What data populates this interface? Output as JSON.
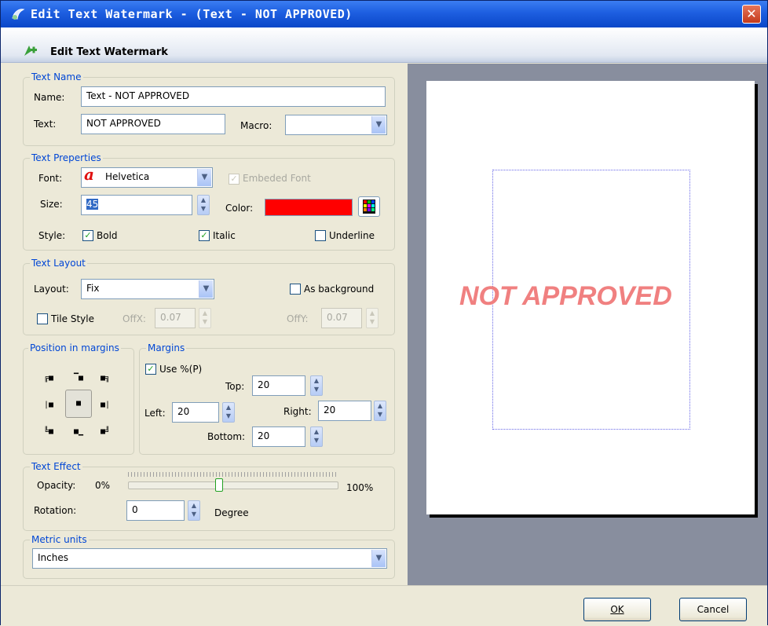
{
  "window": {
    "title": "Edit Text Watermark - (Text - NOT APPROVED)"
  },
  "banner": {
    "label": "Edit Text Watermark"
  },
  "text_name": {
    "group_label": "Text Name",
    "name_label": "Name:",
    "name_value": "Text - NOT APPROVED",
    "text_label": "Text:",
    "text_value": "NOT APPROVED",
    "macro_label": "Macro:",
    "macro_value": ""
  },
  "text_properties": {
    "group_label": "Text Preperties",
    "font_label": "Font:",
    "font_value": "Helvetica",
    "embedded_font_label": "Embeded Font",
    "embedded_font_checked": true,
    "size_label": "Size:",
    "size_value": "45",
    "color_label": "Color:",
    "color_value": "#ff0000",
    "style_label": "Style:",
    "bold_label": "Bold",
    "bold_checked": true,
    "italic_label": "Italic",
    "italic_checked": true,
    "underline_label": "Underline",
    "underline_checked": false
  },
  "text_layout": {
    "group_label": "Text Layout",
    "layout_label": "Layout:",
    "layout_value": "Fix",
    "as_background_label": "As background",
    "as_background_checked": false,
    "tile_style_label": "Tile Style",
    "tile_style_checked": false,
    "offx_label": "OffX:",
    "offx_value": "0.07",
    "offy_label": "OffY:",
    "offy_value": "0.07"
  },
  "position": {
    "group_label": "Position in margins",
    "selected": "center"
  },
  "margins": {
    "group_label": "Margins",
    "use_percent_label": "Use %(P)",
    "use_percent_checked": true,
    "top_label": "Top:",
    "top_value": "20",
    "left_label": "Left:",
    "left_value": "20",
    "right_label": "Right:",
    "right_value": "20",
    "bottom_label": "Bottom:",
    "bottom_value": "20"
  },
  "text_effect": {
    "group_label": "Text Effect",
    "opacity_label": "Opacity:",
    "opacity_min": "0%",
    "opacity_max": "100%",
    "opacity_value": 0.43,
    "rotation_label": "Rotation:",
    "rotation_value": "0",
    "degree_label": "Degree"
  },
  "metric": {
    "group_label": "Metric units",
    "value": "Inches"
  },
  "preview": {
    "watermark_text": "NOT APPROVED",
    "watermark_color": "#f08080"
  },
  "buttons": {
    "ok": "OK",
    "cancel": "Cancel"
  }
}
